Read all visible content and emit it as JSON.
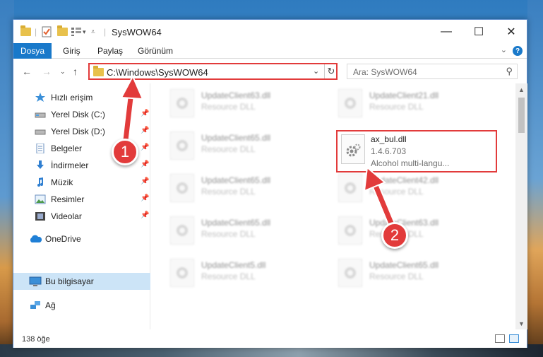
{
  "window": {
    "title": "SysWOW64",
    "minimize": "—",
    "maximize": "☐",
    "close": "✕"
  },
  "ribbon": {
    "file_tab": "Dosya",
    "tabs": [
      "Giriş",
      "Paylaş",
      "Görünüm"
    ],
    "help": "?"
  },
  "nav": {
    "address": "C:\\Windows\\SysWOW64",
    "search_placeholder": "Ara: SysWOW64"
  },
  "sidebar": {
    "items": [
      {
        "label": "Hızlı erişim",
        "icon": "star-icon"
      },
      {
        "label": "Yerel Disk (C:)",
        "icon": "drive-icon",
        "pinned": true
      },
      {
        "label": "Yerel Disk (D:)",
        "icon": "drive-icon",
        "pinned": true
      },
      {
        "label": "Belgeler",
        "icon": "documents-icon",
        "pinned": true
      },
      {
        "label": "İndirmeler",
        "icon": "download-icon",
        "pinned": true
      },
      {
        "label": "Müzik",
        "icon": "music-icon",
        "pinned": true
      },
      {
        "label": "Resimler",
        "icon": "pictures-icon",
        "pinned": true
      },
      {
        "label": "Videolar",
        "icon": "videos-icon",
        "pinned": true
      },
      {
        "label": "OneDrive",
        "icon": "onedrive-icon"
      },
      {
        "label": "Bu bilgisayar",
        "icon": "computer-icon",
        "selected": true
      },
      {
        "label": "Ağ",
        "icon": "network-icon"
      }
    ]
  },
  "files": {
    "left": [
      {
        "name": "UpdateClient63.dll",
        "sub": "Resource DLL"
      },
      {
        "name": "UpdateClient65.dll",
        "sub": "Resource DLL"
      },
      {
        "name": "UpdateClient65.dll",
        "sub": "Resource DLL"
      },
      {
        "name": "UpdateClient65.dll",
        "sub": "Resource DLL"
      },
      {
        "name": "UpdateClient5.dll",
        "sub": "Resource DLL"
      }
    ],
    "right": [
      {
        "name": "UpdateClient21.dll",
        "sub": "Resource DLL"
      },
      {
        "name": "UpdateClient42.dll",
        "sub": "Resource DLL"
      },
      {
        "name": "UpdateClient63.dll",
        "sub": "Resource DLL"
      },
      {
        "name": "UpdateClient65.dll",
        "sub": "Resource DLL"
      }
    ],
    "highlighted": {
      "name": "ax_bul.dll",
      "version": "1.4.6.703",
      "description": "Alcohol multi-langu..."
    }
  },
  "status": {
    "count": "138 öğe"
  },
  "annotations": {
    "step1": "1",
    "step2": "2",
    "color": "#e23b3b"
  }
}
